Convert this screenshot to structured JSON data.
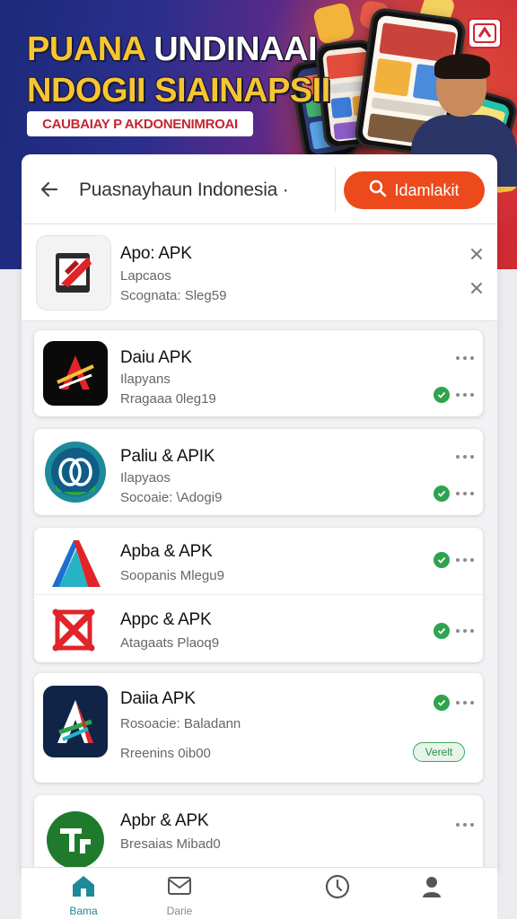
{
  "banner": {
    "title_line1_yellow": "PUANA ",
    "title_line1_white": "UNDINAAI",
    "title_line2": "NDOGII SIAINAPSII",
    "tagline": "CAUBAIAY P AKDONENIMROAI"
  },
  "colors": {
    "accent": "#ec4a1c",
    "verified_green": "#2fa34f",
    "active_nav": "#1d8a9a"
  },
  "search": {
    "back_icon": "arrow-left-icon",
    "query": "Puasnayhaun  Indonesia  ·",
    "button_icon": "search-icon",
    "button_label": "Idamlakit"
  },
  "first_result": {
    "name": "Apo: APK",
    "line1": "Lapcaos",
    "line2": "Scognata: Sleg59"
  },
  "apps": [
    {
      "name": "Daiu APK",
      "line1": "Ilapyans",
      "line2": "Rragaaa  0leg19",
      "verified": true
    },
    {
      "name": "Paliu & APIK",
      "line1": "Ilapyaos",
      "line2": "Socoaie: \\Adogi9",
      "verified": true
    },
    {
      "name": "Apba & APK",
      "line1": "Soopanis Mlegu9",
      "verified": true
    },
    {
      "name": "Appc & APK",
      "line1": "Atagaats Plaoq9",
      "verified": true
    },
    {
      "name": "Daiia APK",
      "line1": "Rosoacie: Baladann",
      "line2": "Rreenins 0ib00",
      "verified": true,
      "badge": "Verelt"
    },
    {
      "name": "Apbr & APK",
      "line1": "Bresaias Mibad0"
    }
  ],
  "nav": {
    "items": [
      {
        "label": "Bama",
        "icon": "home-icon",
        "active": true
      },
      {
        "label": "Darie",
        "icon": "mail-icon",
        "active": false
      },
      {
        "label": "",
        "icon": "clock-icon",
        "active": false
      },
      {
        "label": "",
        "icon": "profile-icon",
        "active": false
      }
    ]
  }
}
